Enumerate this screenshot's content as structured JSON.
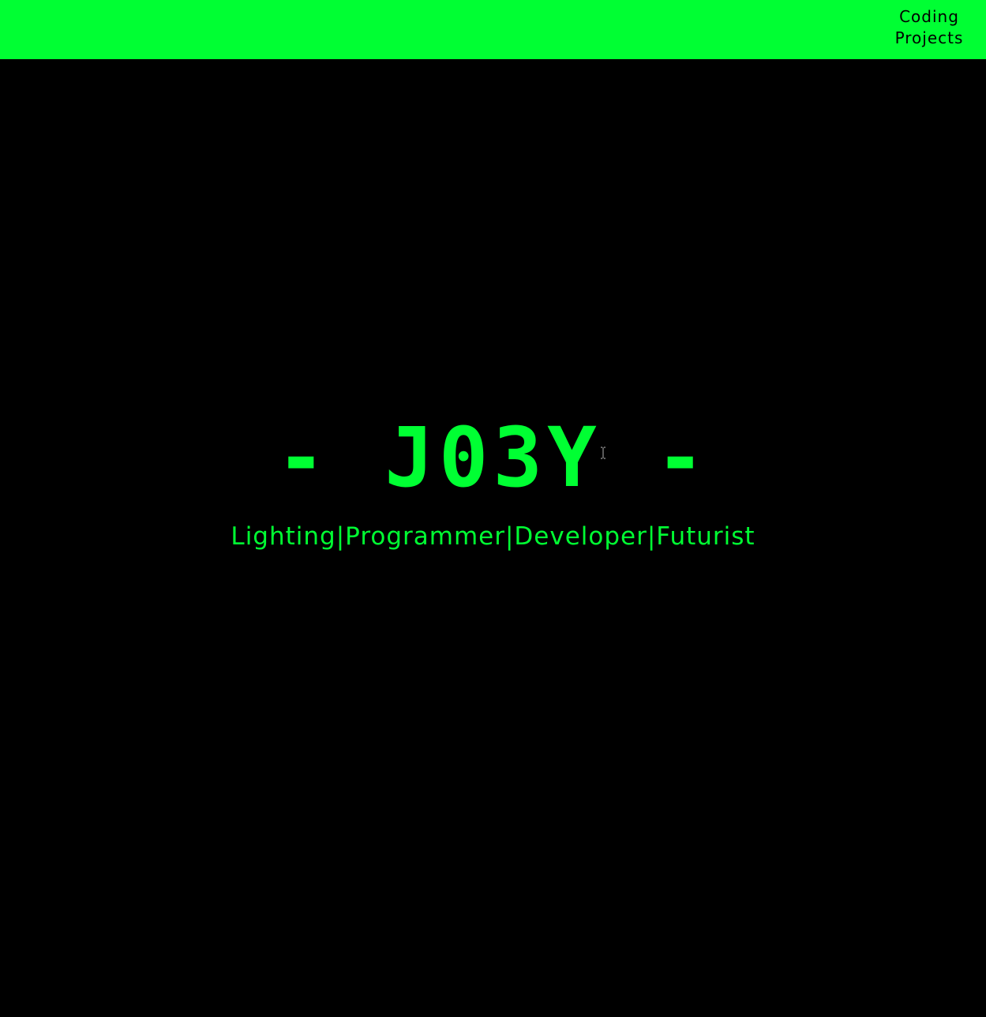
{
  "colors": {
    "accent": "#00ff33",
    "background": "#000000",
    "nav_text": "#000000"
  },
  "header": {
    "nav_link_label": "Coding Projects"
  },
  "hero": {
    "title": "- J03Y -",
    "subtitle": "Lighting|Programmer|Developer|Futurist"
  },
  "cursor": {
    "icon": "text-cursor-icon"
  }
}
